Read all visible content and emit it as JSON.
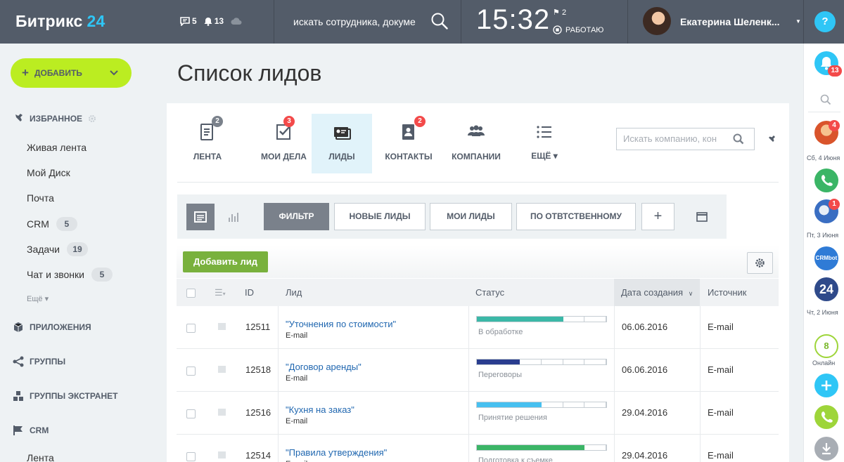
{
  "colors": {
    "topbar": "#535c69",
    "accent": "#2fc6f6",
    "add_button": "#bbed21",
    "lead_button": "#79b13d",
    "link": "#2067b0",
    "badge_red": "#f34a4a"
  },
  "header": {
    "logo_text": "Битрикс",
    "logo_num": "24",
    "messages_count": "5",
    "notifications_count": "13",
    "search_placeholder": "искать сотрудника, докуме",
    "clock": "15:32",
    "flags_count": "2",
    "work_status": "РАБОТАЮ",
    "user_name": "Екатерина Шеленк...",
    "help_label": "?"
  },
  "sidebar": {
    "add_label": "ДОБАВИТЬ",
    "favorites_label": "ИЗБРАННОЕ",
    "items": [
      {
        "label": "Живая лента",
        "badge": ""
      },
      {
        "label": "Мой Диск",
        "badge": ""
      },
      {
        "label": "Почта",
        "badge": ""
      },
      {
        "label": "CRM",
        "badge": "5"
      },
      {
        "label": "Задачи",
        "badge": "19"
      },
      {
        "label": "Чат и звонки",
        "badge": "5"
      }
    ],
    "more_label": "Ещё",
    "sections": [
      {
        "label": "ПРИЛОЖЕНИЯ"
      },
      {
        "label": "ГРУППЫ"
      },
      {
        "label": "ГРУППЫ ЭКСТРАНЕТ"
      },
      {
        "label": "CRM"
      }
    ],
    "crm_sub_label": "Лента"
  },
  "page": {
    "title": "Список лидов"
  },
  "tabs": [
    {
      "label": "ЛЕНТА",
      "count": "2",
      "count_color": "#7a818b",
      "icon": "feed-icon"
    },
    {
      "label": "МОИ ДЕЛА",
      "count": "3",
      "count_color": "#f34a4a",
      "icon": "tasks-icon"
    },
    {
      "label": "ЛИДЫ",
      "count": "",
      "count_color": "",
      "icon": "leads-icon"
    },
    {
      "label": "КОНТАКТЫ",
      "count": "2",
      "count_color": "#f34a4a",
      "icon": "contacts-icon"
    },
    {
      "label": "КОМПАНИИ",
      "count": "",
      "count_color": "",
      "icon": "companies-icon"
    },
    {
      "label": "ЕЩЁ",
      "count": "",
      "count_color": "",
      "icon": "list-icon"
    }
  ],
  "tab_search_placeholder": "Искать компанию, кон",
  "filters": {
    "filter_label": "ФИЛЬТР",
    "presets": [
      "НОВЫЕ ЛИДЫ",
      "МОИ ЛИДЫ",
      "ПО ОТВТСТВЕННОМУ"
    ],
    "add_label": "+"
  },
  "toolbar": {
    "add_lead_label": "Добавить лид"
  },
  "table": {
    "columns": {
      "id": "ID",
      "lead": "Лид",
      "status": "Статус",
      "created": "Дата создания",
      "source": "Источник"
    },
    "rows": [
      {
        "id": "12511",
        "title": "\"Уточнения по стоимости\"",
        "sub": "E-mail",
        "status": "В обработке",
        "progress": 0.67,
        "bar_color": "#3bb8a7",
        "created": "06.06.2016",
        "source": "E-mail"
      },
      {
        "id": "12518",
        "title": "\"Договор аренды\"",
        "sub": "E-mail",
        "status": "Переговоры",
        "progress": 0.33,
        "bar_color": "#2a3d8f",
        "created": "06.06.2016",
        "source": "E-mail"
      },
      {
        "id": "12516",
        "title": "\"Кухня на заказ\"",
        "sub": "E-mail",
        "status": "Принятие решения",
        "progress": 0.5,
        "bar_color": "#47c0f0",
        "created": "29.04.2016",
        "source": "E-mail"
      },
      {
        "id": "12514",
        "title": "\"Правила утверждения\"",
        "sub": "E-mail",
        "status": "Подготовка к съемке",
        "progress": 0.83,
        "bar_color": "#3bb566",
        "created": "29.04.2016",
        "source": "E-mail"
      }
    ]
  },
  "right_bar": {
    "notifications_count": "13",
    "chats": [
      {
        "count": "4",
        "date": "Сб, 4 Июня"
      },
      {
        "count": "",
        "date": ""
      },
      {
        "count": "1",
        "date": "Пт, 3 Июня"
      },
      {
        "count": "",
        "date": "",
        "label": "CRMbot"
      },
      {
        "count": "",
        "date": "Чт, 2 Июня",
        "label": "24"
      }
    ],
    "online_count": "8",
    "online_label": "Онлайн"
  }
}
